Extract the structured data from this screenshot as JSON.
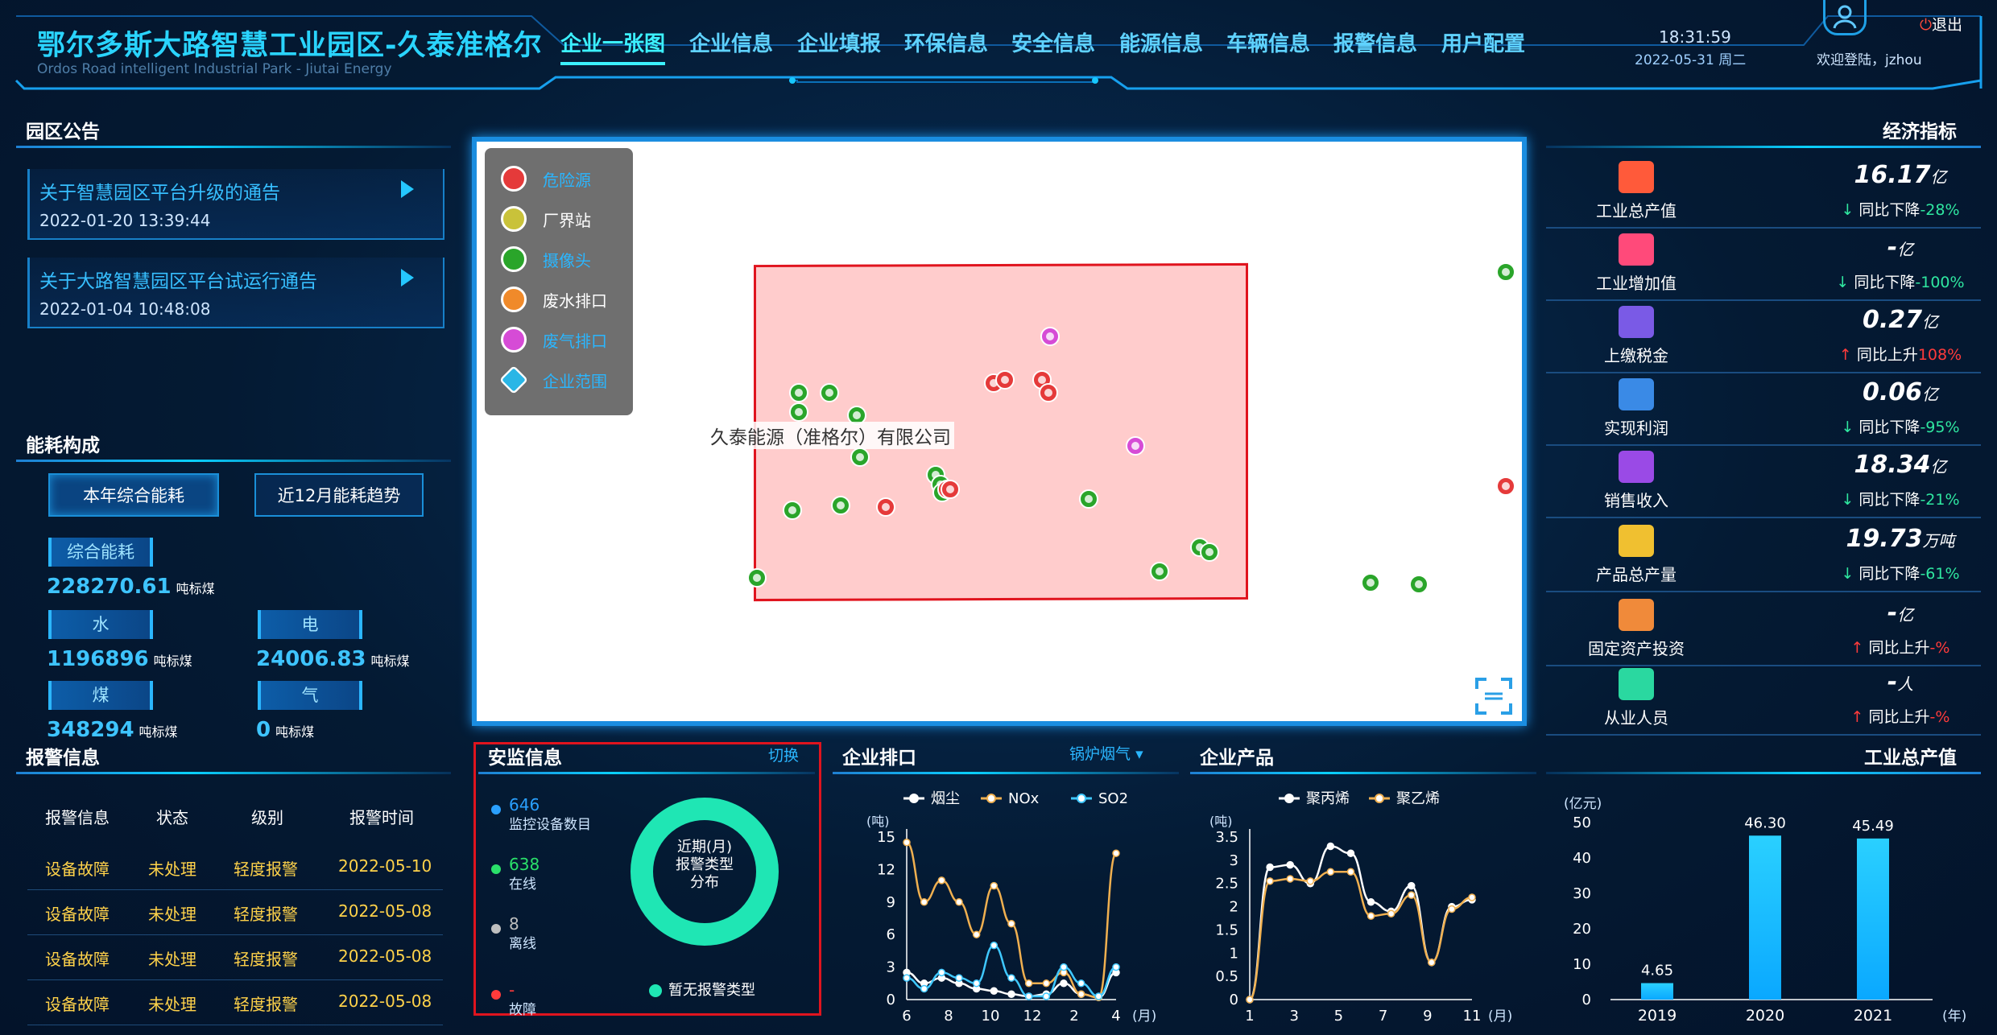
{
  "header": {
    "title": "鄂尔多斯大路智慧工业园区-久泰准格尔",
    "subtitle": "Ordos Road intelligent Industrial Park - Jiutai Energy",
    "nav": [
      "企业一张图",
      "企业信息",
      "企业填报",
      "环保信息",
      "安全信息",
      "能源信息",
      "车辆信息",
      "报警信息",
      "用户配置"
    ],
    "time": "18:31:59",
    "date": "2022-05-31 周二",
    "welcome": "欢迎登陆，jzhou",
    "logout": "退出"
  },
  "notices": {
    "title": "园区公告",
    "items": [
      {
        "title": "关于智慧园区平台升级的通告",
        "date": "2022-01-20 13:39:44"
      },
      {
        "title": "关于大路智慧园区平台试运行通告",
        "date": "2022-01-04 10:48:08"
      }
    ]
  },
  "energy": {
    "title": "能耗构成",
    "tab1": "本年综合能耗",
    "tab2": "近12月能耗趋势",
    "total_label": "综合能耗",
    "total_value": "228270.61",
    "unit": "吨标煤",
    "water_label": "水",
    "water_value": "1196896",
    "elec_label": "电",
    "elec_value": "24006.83",
    "coal_label": "煤",
    "coal_value": "348294",
    "gas_label": "气",
    "gas_value": "0"
  },
  "alarms": {
    "title": "报警信息",
    "headers": [
      "报警信息",
      "状态",
      "级别",
      "报警时间"
    ],
    "rows": [
      [
        "设备故障",
        "未处理",
        "轻度报警",
        "2022-05-10"
      ],
      [
        "设备故障",
        "未处理",
        "轻度报警",
        "2022-05-08"
      ],
      [
        "设备故障",
        "未处理",
        "轻度报警",
        "2022-05-08"
      ],
      [
        "设备故障",
        "未处理",
        "轻度报警",
        "2022-05-08"
      ]
    ]
  },
  "map": {
    "legend": [
      {
        "label": "危险源",
        "color": "#e53a3a",
        "icon": "hazard-icon"
      },
      {
        "label": "厂界站",
        "color": "#c9c23a",
        "icon": "boundary-station-icon"
      },
      {
        "label": "摄像头",
        "color": "#2aa52a",
        "icon": "camera-icon"
      },
      {
        "label": "废水排口",
        "color": "#f08a2a",
        "icon": "wastewater-icon"
      },
      {
        "label": "废气排口",
        "color": "#d64bd6",
        "icon": "exhaust-icon"
      },
      {
        "label": "企业范围",
        "color": "#2ab6e6",
        "icon": "enterprise-area-icon"
      }
    ],
    "company_label": "久泰能源（准格尔）有限公司"
  },
  "economy": {
    "title": "经济指标",
    "items": [
      {
        "name": "工业总产值",
        "value": "16.17",
        "unit": "亿",
        "change": "同比下降",
        "pct": "-28%",
        "dir": "down",
        "icon": "output-value-icon",
        "color": "#ff5a3a"
      },
      {
        "name": "工业增加值",
        "value": "-",
        "unit": "亿",
        "change": "同比下降",
        "pct": "-100%",
        "dir": "down",
        "icon": "added-value-icon",
        "color": "#ff4a7a"
      },
      {
        "name": "上缴税金",
        "value": "0.27",
        "unit": "亿",
        "change": "同比上升",
        "pct": "108%",
        "dir": "up",
        "icon": "tax-icon",
        "color": "#7a5ae6"
      },
      {
        "name": "实现利润",
        "value": "0.06",
        "unit": "亿",
        "change": "同比下降",
        "pct": "-95%",
        "dir": "down",
        "icon": "profit-icon",
        "color": "#3a8ae6"
      },
      {
        "name": "销售收入",
        "value": "18.34",
        "unit": "亿",
        "change": "同比下降",
        "pct": "-21%",
        "dir": "down",
        "icon": "sales-icon",
        "color": "#9a4ae6"
      },
      {
        "name": "产品总产量",
        "value": "19.73",
        "unit": "万吨",
        "change": "同比下降",
        "pct": "-61%",
        "dir": "down",
        "icon": "production-icon",
        "color": "#f0c030"
      },
      {
        "name": "固定资产投资",
        "value": "-",
        "unit": "亿",
        "change": "同比上升",
        "pct": "-%",
        "dir": "up",
        "icon": "investment-icon",
        "color": "#f08a3a"
      },
      {
        "name": "从业人员",
        "value": "-",
        "unit": "人",
        "change": "同比上升",
        "pct": "-%",
        "dir": "up",
        "icon": "staff-icon",
        "color": "#2ad8a0"
      }
    ]
  },
  "safety": {
    "title": "安监信息",
    "switch": "切换",
    "stats": [
      {
        "value": "646",
        "label": "监控设备数目",
        "color": "#2aa0ff"
      },
      {
        "value": "638",
        "label": "在线",
        "color": "#2ae06a"
      },
      {
        "value": "8",
        "label": "离线",
        "color": "#bfbfbf"
      },
      {
        "value": "-",
        "label": "故障",
        "color": "#ff3b3b"
      }
    ],
    "donut_text": [
      "近期(月)",
      "报警类型",
      "分布"
    ],
    "legend": "暂无报警类型"
  },
  "outlet": {
    "title": "企业排口",
    "selector": "锅炉烟气",
    "chart_data": {
      "type": "line",
      "ylabel": "(吨)",
      "xlabel": "(月)",
      "ylim": [
        0,
        15
      ],
      "yticks": [
        0,
        3,
        6,
        9,
        12,
        15
      ],
      "xticks": [
        "6",
        "8",
        "10",
        "12",
        "2",
        "4"
      ],
      "series": [
        {
          "name": "烟尘",
          "color": "#ffffff",
          "values": [
            2.5,
            1.5,
            2.0,
            1.5,
            1.0,
            0.8,
            0.5,
            0.3,
            0.5,
            1.5,
            0.5,
            0.2,
            2.5
          ]
        },
        {
          "name": "NOx",
          "color": "#f0b050",
          "values": [
            14.5,
            9.0,
            11.0,
            9.0,
            6.0,
            10.5,
            7.0,
            1.5,
            1.5,
            2.5,
            0.5,
            0.2,
            13.5
          ]
        },
        {
          "name": "SO2",
          "color": "#3fc8ff",
          "values": [
            2.0,
            1.0,
            2.5,
            2.0,
            1.5,
            5.0,
            2.0,
            0.3,
            0.3,
            3.0,
            1.5,
            0.3,
            3.0
          ]
        }
      ]
    }
  },
  "products": {
    "title": "企业产品",
    "chart_data": {
      "type": "line",
      "ylabel": "(吨)",
      "xlabel": "(月)",
      "ylim": [
        0,
        3.5
      ],
      "yticks": [
        0,
        0.5,
        1,
        1.5,
        2,
        2.5,
        3,
        3.5
      ],
      "xticks": [
        "1",
        "3",
        "5",
        "7",
        "9",
        "11"
      ],
      "series": [
        {
          "name": "聚丙烯",
          "color": "#ffffff",
          "values": [
            0,
            2.85,
            2.9,
            2.5,
            3.3,
            3.15,
            2.1,
            1.9,
            2.45,
            0.8,
            2.0,
            2.15
          ]
        },
        {
          "name": "聚乙烯",
          "color": "#f0b050",
          "values": [
            0,
            2.55,
            2.6,
            2.55,
            2.75,
            2.75,
            1.8,
            1.85,
            2.25,
            0.8,
            1.95,
            2.2
          ]
        }
      ]
    }
  },
  "output": {
    "title": "工业总产值",
    "chart_data": {
      "type": "bar",
      "ylabel": "(亿元)",
      "xlabel": "(年)",
      "categories": [
        "2019",
        "2020",
        "2021"
      ],
      "values": [
        4.65,
        46.3,
        45.49
      ],
      "ylim": [
        0,
        50
      ],
      "yticks": [
        0,
        10,
        20,
        30,
        40,
        50
      ]
    }
  }
}
